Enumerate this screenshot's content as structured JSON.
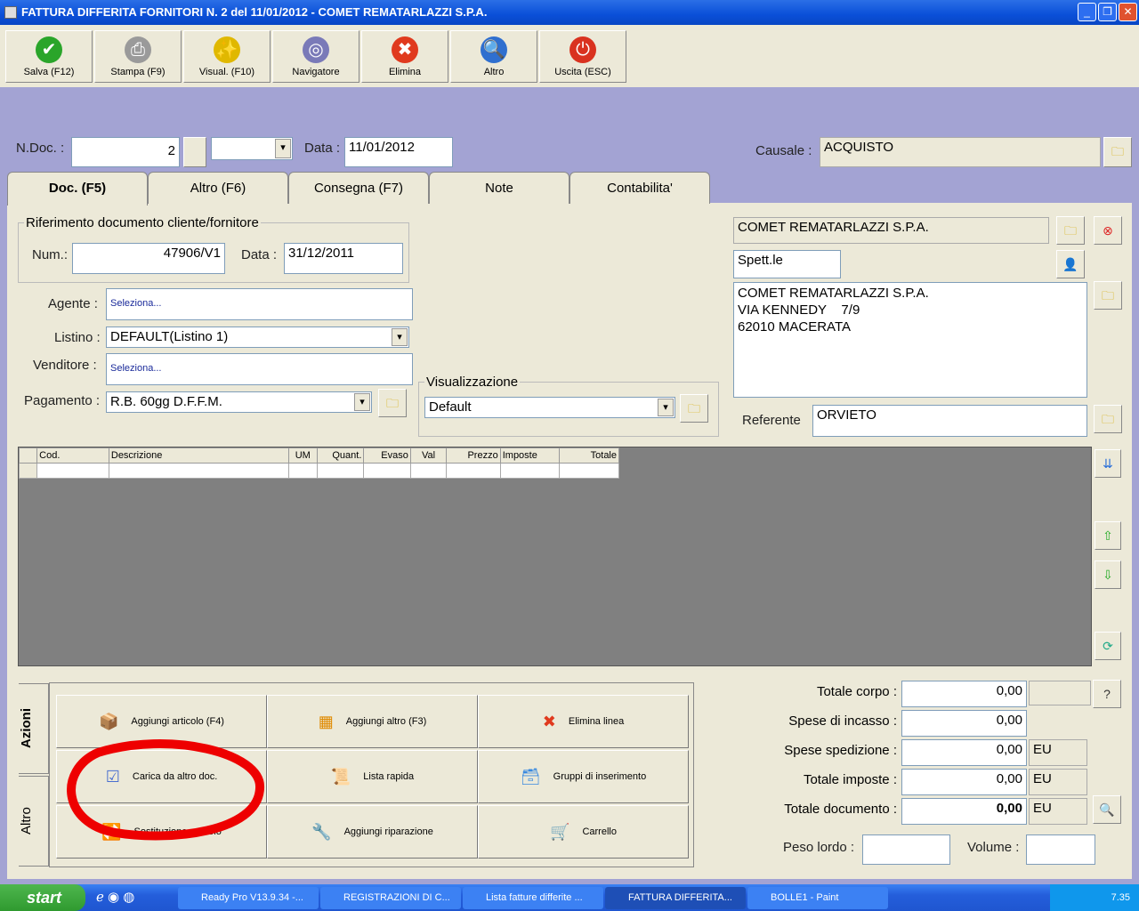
{
  "window": {
    "title": "FATTURA DIFFERITA FORNITORI N. 2  del 11/01/2012 - COMET REMATARLAZZI S.P.A."
  },
  "toolbar": [
    {
      "label": "Salva (F12)",
      "icon": "check-icon",
      "color": "#2aa52a",
      "glyph": "✔"
    },
    {
      "label": "Stampa (F9)",
      "icon": "printer-icon",
      "color": "#9a9a9a",
      "glyph": "⎙"
    },
    {
      "label": "Visual. (F10)",
      "icon": "magic-wand-icon",
      "color": "#e0b800",
      "glyph": "✨"
    },
    {
      "label": "Navigatore",
      "icon": "compass-icon",
      "color": "#7a7ab8",
      "glyph": "◎"
    },
    {
      "label": "Elimina",
      "icon": "x-icon",
      "color": "#e03a1e",
      "glyph": "✖"
    },
    {
      "label": "Altro",
      "icon": "book-search-icon",
      "color": "#2f6fcf",
      "glyph": "🔍"
    },
    {
      "label": "Uscita (ESC)",
      "icon": "power-icon",
      "color": "#d9321f",
      "glyph": "⏻"
    }
  ],
  "header": {
    "ndoc_label": "N.Doc. :",
    "ndoc": "2",
    "data_label": "Data :",
    "data": "11/01/2012",
    "causale_label": "Causale :",
    "causale": "ACQUISTO"
  },
  "tabs": [
    "Doc. (F5)",
    "Altro (F6)",
    "Consegna (F7)",
    "Note",
    "Contabilita'"
  ],
  "riferimento": {
    "legend": "Riferimento documento cliente/fornitore",
    "num_label": "Num.:",
    "num": "47906/V1",
    "data_label": "Data :",
    "data": "31/12/2011"
  },
  "form": {
    "agente_label": "Agente :",
    "agente": "Seleziona...",
    "listino_label": "Listino :",
    "listino": "DEFAULT(Listino 1)",
    "venditore_label": "Venditore :",
    "venditore": "Seleziona...",
    "pagamento_label": "Pagamento :",
    "pagamento": "R.B. 60gg D.F.F.M.",
    "visual_legend": "Visualizzazione",
    "visual": "Default"
  },
  "cliente": {
    "nome": "COMET REMATARLAZZI S.P.A.",
    "titolo": "Spett.le",
    "indirizzo": [
      "COMET REMATARLAZZI S.P.A.",
      "VIA KENNEDY    7/9",
      "62010 MACERATA"
    ],
    "referente_label": "Referente",
    "referente": "ORVIETO"
  },
  "grid": {
    "columns": [
      "Cod.",
      "Descrizione",
      "UM",
      "Quant.",
      "Evaso",
      "Val",
      "Prezzo",
      "Imposte",
      "Totale"
    ]
  },
  "side_tabs": [
    "Azioni",
    "Altro"
  ],
  "actions": [
    {
      "label": "Aggiungi articolo (F4)",
      "icon": "box-add-icon",
      "glyph": "📦"
    },
    {
      "label": "Aggiungi altro (F3)",
      "icon": "grid-add-icon",
      "glyph": "▦"
    },
    {
      "label": "Elimina linea",
      "icon": "delete-icon",
      "glyph": "✖"
    },
    {
      "label": "Carica da altro doc.",
      "icon": "checklist-icon",
      "glyph": "☑"
    },
    {
      "label": "Lista rapida",
      "icon": "list-add-icon",
      "glyph": "📜"
    },
    {
      "label": "Gruppi di inserimento",
      "icon": "group-add-icon",
      "glyph": "🗃"
    },
    {
      "label": "Sostituzione articolo",
      "icon": "swap-icon",
      "glyph": "🔁"
    },
    {
      "label": "Aggiungi riparazione",
      "icon": "wrench-icon",
      "glyph": "🔧"
    },
    {
      "label": "Carrello",
      "icon": "cart-icon",
      "glyph": "🛒"
    }
  ],
  "totals": [
    {
      "label": "Totale corpo :",
      "value": "0,00",
      "unit": ""
    },
    {
      "label": "Spese di incasso :",
      "value": "0,00",
      "unit": ""
    },
    {
      "label": "Spese spedizione :",
      "value": "0,00",
      "unit": "EU"
    },
    {
      "label": "Totale imposte :",
      "value": "0,00",
      "unit": "EU"
    },
    {
      "label": "Totale documento :",
      "value": "0,00",
      "unit": "EU"
    }
  ],
  "peso_label": "Peso lordo :",
  "volume_label": "Volume :",
  "help": "?",
  "taskbar": {
    "start": "start",
    "tasks": [
      "Ready Pro V13.9.34 -...",
      "REGISTRAZIONI DI C...",
      "Lista fatture differite ...",
      "FATTURA DIFFERITA...",
      "BOLLE1 - Paint"
    ],
    "clock": "7.35"
  }
}
